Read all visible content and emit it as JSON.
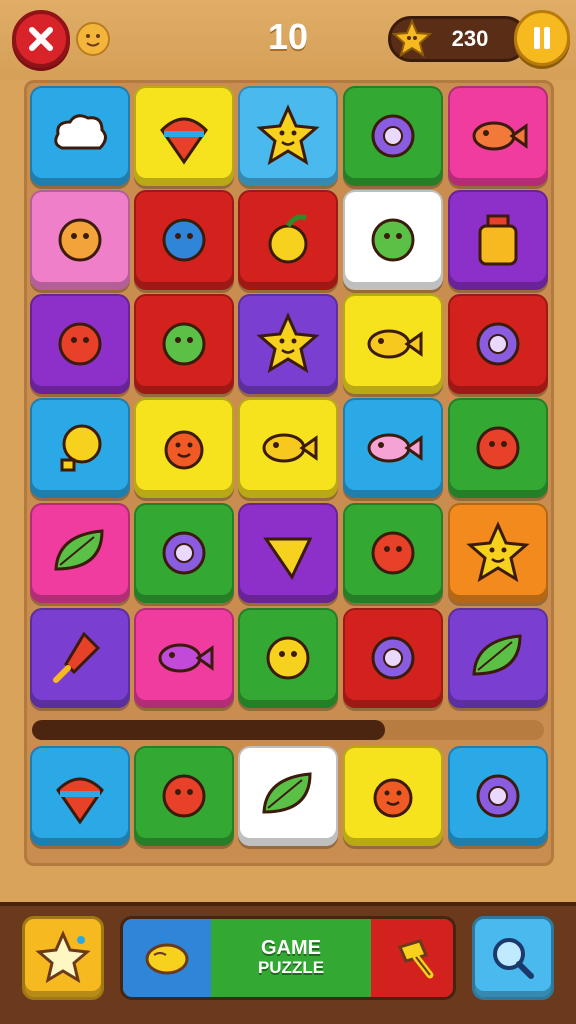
{
  "header": {
    "level_number": "10",
    "coins": "230",
    "icons": [
      "close-icon",
      "smiley-icon",
      "star-icon",
      "pause-icon"
    ]
  },
  "board": {
    "rows": [
      [
        {
          "color": "#2aa9e6",
          "icon": "cloud-icon"
        },
        {
          "color": "#f7e21e",
          "icon": "spinning-top-icon"
        },
        {
          "color": "#49b9ee",
          "icon": "star-face-icon"
        },
        {
          "color": "#33a934",
          "icon": "spinning-disc-icon"
        },
        {
          "color": "#ef3c9e",
          "icon": "fish-icon"
        }
      ],
      [
        {
          "color": "#f07fca",
          "icon": "bird-icon"
        },
        {
          "color": "#d3221d",
          "icon": "blue-bird-icon"
        },
        {
          "color": "#d3221d",
          "icon": "apple-icon"
        },
        {
          "color": "#ffffff",
          "icon": "green-blob-icon"
        },
        {
          "color": "#8d2fc9",
          "icon": "jar-icon"
        }
      ],
      [
        {
          "color": "#8d2fc9",
          "icon": "tomato-pin-icon"
        },
        {
          "color": "#d3221d",
          "icon": "green-bird-icon"
        },
        {
          "color": "#7a3fd1",
          "icon": "star-face-icon"
        },
        {
          "color": "#f7e21e",
          "icon": "yellow-fish-icon"
        },
        {
          "color": "#d3221d",
          "icon": "disc-spinner-icon"
        }
      ],
      [
        {
          "color": "#2aa9e6",
          "icon": "bulb-face-icon"
        },
        {
          "color": "#f7e21e",
          "icon": "sun-face-icon"
        },
        {
          "color": "#f7e21e",
          "icon": "yellow-fish-icon"
        },
        {
          "color": "#2aa9e6",
          "icon": "pink-fish-icon"
        },
        {
          "color": "#33a934",
          "icon": "red-bird-icon"
        }
      ],
      [
        {
          "color": "#ef3c9e",
          "icon": "leaf-icon"
        },
        {
          "color": "#33a934",
          "icon": "spinning-disc-icon"
        },
        {
          "color": "#8d2fc9",
          "icon": "cheese-icon"
        },
        {
          "color": "#33a934",
          "icon": "red-ball-icon"
        },
        {
          "color": "#f28a1d",
          "icon": "star-face-icon"
        }
      ],
      [
        {
          "color": "#7a3fd1",
          "icon": "dagger-icon"
        },
        {
          "color": "#ef3c9e",
          "icon": "purple-fish-icon"
        },
        {
          "color": "#33a934",
          "icon": "yellow-blob-icon"
        },
        {
          "color": "#d3221d",
          "icon": "purple-spinner-icon"
        },
        {
          "color": "#7a3fd1",
          "icon": "green-leaf-icon"
        }
      ]
    ],
    "progress": 0.69,
    "tray": [
      {
        "color": "#2aa9e6",
        "icon": "spinning-top-icon"
      },
      {
        "color": "#33a934",
        "icon": "red-blob-icon"
      },
      {
        "color": "#ffffff",
        "icon": "green-leaf-ball-icon"
      },
      {
        "color": "#f7e21e",
        "icon": "sun-face-icon"
      },
      {
        "color": "#2aa9e6",
        "icon": "compass-disc-icon"
      }
    ]
  },
  "bottom_bar": {
    "star_button_icon": "star-power-icon",
    "left_segment_icon": "lemon-icon",
    "game_label_line1": "GAME",
    "game_label_line2": "PUZZLE",
    "right_segment_icon": "hammer-icon",
    "search_button_icon": "magnifier-icon"
  }
}
